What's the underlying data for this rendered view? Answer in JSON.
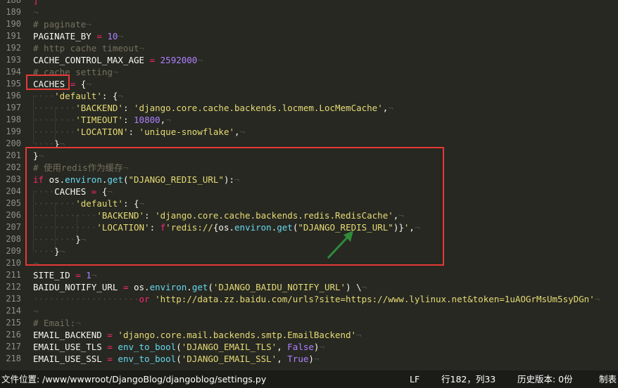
{
  "editor": {
    "lines": [
      {
        "n": "188",
        "t": [
          [
            "op",
            "]"
          ]
        ]
      },
      {
        "n": "189",
        "t": [
          [
            "ws",
            "¬"
          ]
        ]
      },
      {
        "n": "190",
        "t": [
          [
            "cm",
            "# paginate"
          ],
          [
            "ws",
            "¬"
          ]
        ]
      },
      {
        "n": "191",
        "t": [
          [
            "p",
            "PAGINATE_BY "
          ],
          [
            "op",
            "="
          ],
          [
            "p",
            " "
          ],
          [
            "num",
            "10"
          ],
          [
            "ws",
            "¬"
          ]
        ]
      },
      {
        "n": "192",
        "t": [
          [
            "cm",
            "# http cache timeout"
          ],
          [
            "ws",
            "¬"
          ]
        ]
      },
      {
        "n": "193",
        "t": [
          [
            "p",
            "CACHE_CONTROL_MAX_AGE "
          ],
          [
            "op",
            "="
          ],
          [
            "p",
            " "
          ],
          [
            "num",
            "2592000"
          ],
          [
            "ws",
            "¬"
          ]
        ]
      },
      {
        "n": "194",
        "t": [
          [
            "cm",
            "# cache setting"
          ],
          [
            "ws",
            "¬"
          ]
        ]
      },
      {
        "n": "195",
        "t": [
          [
            "p",
            "CACHES "
          ],
          [
            "op",
            "="
          ],
          [
            "p",
            " {"
          ],
          [
            "ws",
            "¬"
          ]
        ]
      },
      {
        "n": "196",
        "t": [
          [
            "ws",
            "····"
          ],
          [
            "str",
            "'default'"
          ],
          [
            "p",
            ": {"
          ],
          [
            "ws",
            "¬"
          ]
        ]
      },
      {
        "n": "197",
        "t": [
          [
            "ws",
            "········"
          ],
          [
            "str",
            "'BACKEND'"
          ],
          [
            "p",
            ": "
          ],
          [
            "str",
            "'django.core.cache.backends.locmem.LocMemCache'"
          ],
          [
            "p",
            ","
          ],
          [
            "ws",
            "¬"
          ]
        ]
      },
      {
        "n": "198",
        "t": [
          [
            "ws",
            "········"
          ],
          [
            "str",
            "'TIMEOUT'"
          ],
          [
            "p",
            ": "
          ],
          [
            "num",
            "10800"
          ],
          [
            "p",
            ","
          ],
          [
            "ws",
            "¬"
          ]
        ]
      },
      {
        "n": "199",
        "t": [
          [
            "ws",
            "········"
          ],
          [
            "str",
            "'LOCATION'"
          ],
          [
            "p",
            ": "
          ],
          [
            "str",
            "'unique-snowflake'"
          ],
          [
            "p",
            ","
          ],
          [
            "ws",
            "¬"
          ]
        ]
      },
      {
        "n": "200",
        "t": [
          [
            "ws",
            "····"
          ],
          [
            "p",
            "}"
          ],
          [
            "ws",
            "¬"
          ]
        ]
      },
      {
        "n": "201",
        "t": [
          [
            "p",
            "}"
          ],
          [
            "ws",
            "¬"
          ]
        ]
      },
      {
        "n": "202",
        "t": [
          [
            "cm",
            "# 使用redis作为缓存"
          ],
          [
            "ws",
            "¬"
          ]
        ]
      },
      {
        "n": "203",
        "t": [
          [
            "kw",
            "if"
          ],
          [
            "p",
            " os."
          ],
          [
            "fn",
            "environ"
          ],
          [
            "p",
            "."
          ],
          [
            "fn",
            "get"
          ],
          [
            "p",
            "("
          ],
          [
            "str",
            "\"DJANGO_REDIS_URL\""
          ],
          [
            "p",
            "):"
          ],
          [
            "ws",
            "¬"
          ]
        ]
      },
      {
        "n": "204",
        "t": [
          [
            "ws",
            "····"
          ],
          [
            "p",
            "CACHES "
          ],
          [
            "op",
            "="
          ],
          [
            "p",
            " {"
          ],
          [
            "ws",
            "¬"
          ]
        ]
      },
      {
        "n": "205",
        "t": [
          [
            "ws",
            "········"
          ],
          [
            "str",
            "'default'"
          ],
          [
            "p",
            ": {"
          ],
          [
            "ws",
            "¬"
          ]
        ]
      },
      {
        "n": "206",
        "t": [
          [
            "ws",
            "············"
          ],
          [
            "str",
            "'BACKEND'"
          ],
          [
            "p",
            ": "
          ],
          [
            "str",
            "'django.core.cache.backends.redis.RedisCache'"
          ],
          [
            "p",
            ","
          ],
          [
            "ws",
            "¬"
          ]
        ]
      },
      {
        "n": "207",
        "t": [
          [
            "ws",
            "············"
          ],
          [
            "str",
            "'LOCATION'"
          ],
          [
            "p",
            ": "
          ],
          [
            "kw",
            "f"
          ],
          [
            "str",
            "'redis://"
          ],
          [
            "p",
            "{os."
          ],
          [
            "fn",
            "environ"
          ],
          [
            "p",
            "."
          ],
          [
            "fn",
            "get"
          ],
          [
            "p",
            "("
          ],
          [
            "str",
            "\"DJANGO_REDIS_URL\""
          ],
          [
            "p",
            ")}"
          ],
          [
            "str",
            "'"
          ],
          [
            "p",
            ","
          ],
          [
            "ws",
            "¬"
          ]
        ]
      },
      {
        "n": "208",
        "t": [
          [
            "ws",
            "········"
          ],
          [
            "p",
            "}"
          ],
          [
            "ws",
            "¬"
          ]
        ]
      },
      {
        "n": "209",
        "t": [
          [
            "ws",
            "····"
          ],
          [
            "p",
            "}"
          ],
          [
            "ws",
            "¬"
          ]
        ]
      },
      {
        "n": "210",
        "t": [
          [
            "ws",
            "¬"
          ]
        ]
      },
      {
        "n": "211",
        "t": [
          [
            "p",
            "SITE_ID "
          ],
          [
            "op",
            "="
          ],
          [
            "p",
            " "
          ],
          [
            "num",
            "1"
          ],
          [
            "ws",
            "¬"
          ]
        ]
      },
      {
        "n": "212",
        "t": [
          [
            "p",
            "BAIDU_NOTIFY_URL "
          ],
          [
            "op",
            "="
          ],
          [
            "p",
            " os."
          ],
          [
            "fn",
            "environ"
          ],
          [
            "p",
            "."
          ],
          [
            "fn",
            "get"
          ],
          [
            "p",
            "("
          ],
          [
            "str",
            "'DJANGO_BAIDU_NOTIFY_URL'"
          ],
          [
            "p",
            ") \\"
          ],
          [
            "ws",
            "¬"
          ]
        ]
      },
      {
        "n": "213",
        "t": [
          [
            "ws",
            "····················"
          ],
          [
            "kw",
            "or"
          ],
          [
            "p",
            " "
          ],
          [
            "str",
            "'http://data.zz.baidu.com/urls?site=https://www.lylinux.net&token=1uAOGrMsUm5syDGn'"
          ],
          [
            "ws",
            "¬"
          ]
        ]
      },
      {
        "n": "214",
        "t": [
          [
            "ws",
            "¬"
          ]
        ]
      },
      {
        "n": "215",
        "t": [
          [
            "cm",
            "# Email:"
          ],
          [
            "ws",
            "¬"
          ]
        ]
      },
      {
        "n": "216",
        "t": [
          [
            "p",
            "EMAIL_BACKEND "
          ],
          [
            "op",
            "="
          ],
          [
            "p",
            " "
          ],
          [
            "str",
            "'django.core.mail.backends.smtp.EmailBackend'"
          ],
          [
            "ws",
            "¬"
          ]
        ]
      },
      {
        "n": "217",
        "t": [
          [
            "p",
            "EMAIL_USE_TLS "
          ],
          [
            "op",
            "="
          ],
          [
            "p",
            " "
          ],
          [
            "fn",
            "env_to_bool"
          ],
          [
            "p",
            "("
          ],
          [
            "str",
            "'DJANGO_EMAIL_TLS'"
          ],
          [
            "p",
            ", "
          ],
          [
            "bi",
            "False"
          ],
          [
            "p",
            ")"
          ],
          [
            "ws",
            "¬"
          ]
        ]
      },
      {
        "n": "218",
        "t": [
          [
            "p",
            "EMAIL_USE_SSL "
          ],
          [
            "op",
            "="
          ],
          [
            "p",
            " "
          ],
          [
            "fn",
            "env_to_bool"
          ],
          [
            "p",
            "("
          ],
          [
            "str",
            "'DJANGO_EMAIL_SSL'"
          ],
          [
            "p",
            ", "
          ],
          [
            "bi",
            "True"
          ],
          [
            "p",
            ")"
          ],
          [
            "ws",
            "¬"
          ]
        ]
      }
    ]
  },
  "statusbar": {
    "file_path": "文件位置: /www/wwwroot/DjangoBlog/djangoblog/settings.py",
    "line_ending": "LF",
    "cursor_position": "行182，列33",
    "history_version": "历史版本: 0份",
    "tab_setting": "制表"
  },
  "colors": {
    "background": "#272822",
    "highlight_box": "#e53935",
    "arrow": "#2e8b3a"
  }
}
